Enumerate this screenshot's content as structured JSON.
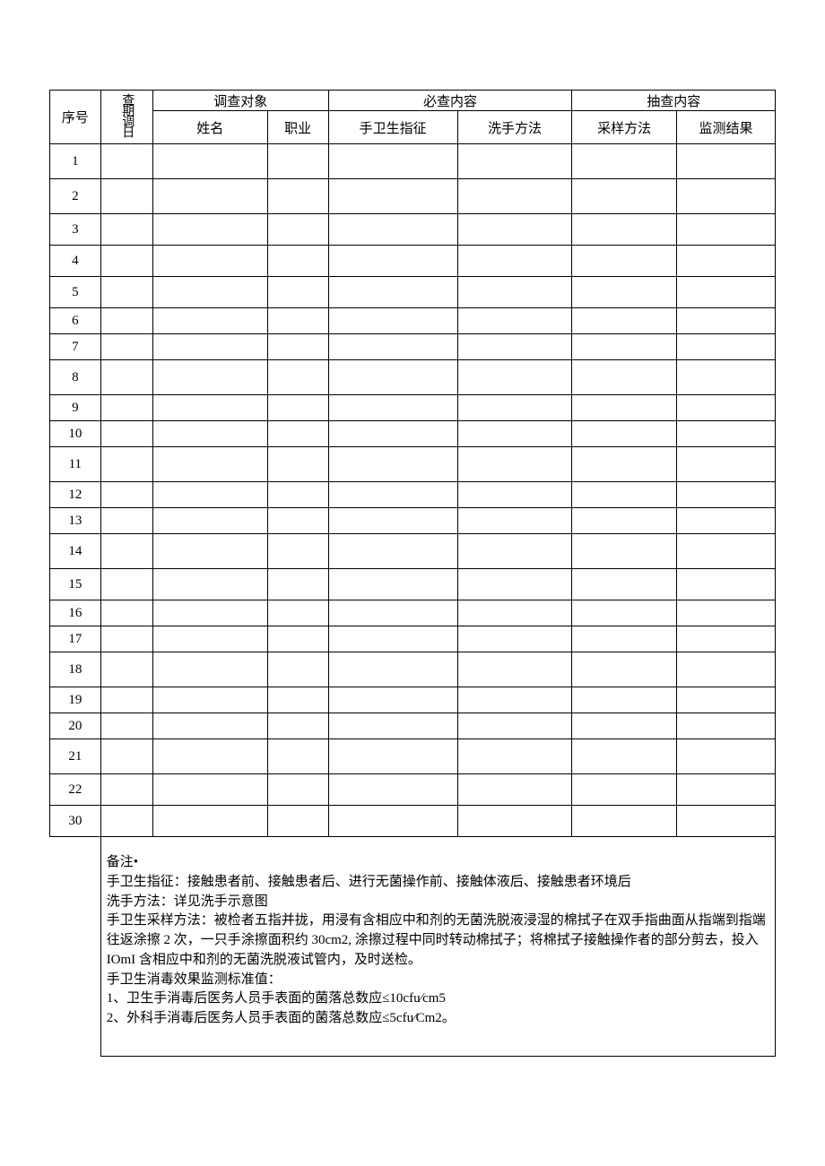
{
  "headers": {
    "col_seq": "序号",
    "col_date": "查期调日",
    "group_subject": "调查对象",
    "group_required": "必查内容",
    "group_sample": "抽查内容",
    "sub_name": "姓名",
    "sub_occupation": "职业",
    "sub_indication": "手卫生指征",
    "sub_wash_method": "洗手方法",
    "sub_sampling_method": "采样方法",
    "sub_result": "监测结果"
  },
  "rows": [
    {
      "seq": "1"
    },
    {
      "seq": "2"
    },
    {
      "seq": "3"
    },
    {
      "seq": "4"
    },
    {
      "seq": "5"
    },
    {
      "seq": "6"
    },
    {
      "seq": "7"
    },
    {
      "seq": "8"
    },
    {
      "seq": "9"
    },
    {
      "seq": "10"
    },
    {
      "seq": "11"
    },
    {
      "seq": "12"
    },
    {
      "seq": "13"
    },
    {
      "seq": "14"
    },
    {
      "seq": "15"
    },
    {
      "seq": "16"
    },
    {
      "seq": "17"
    },
    {
      "seq": "18"
    },
    {
      "seq": "19"
    },
    {
      "seq": "20"
    },
    {
      "seq": "21"
    },
    {
      "seq": "22"
    },
    {
      "seq": "30"
    }
  ],
  "notes": {
    "line0": "备注•",
    "line1": "手卫生指征：接触患者前、接触患者后、进行无菌操作前、接触体液后、接触患者环境后",
    "line2": "洗手方法：详见洗手示意图",
    "line3": "手卫生采样方法：被检者五指并拢，用浸有含相应中和剂的无菌洗脱液浸湿的棉拭子在双手指曲面从指端到指端往返涂擦 2 次，一只手涂擦面积约 30cm2, 涂擦过程中同时转动棉拭子；将棉拭子接触操作者的部分剪去，投入 IOmI 含相应中和剂的无菌洗脱液试管内，及时送检。",
    "line4": "手卫生消毒效果监测标准值：",
    "line5": "1、卫生手消毒后医务人员手表面的菌落总数应≤10cfu∕cm5",
    "line6": "2、外科手消毒后医务人员手表面的菌落总数应≤5cfu∕Cm2。"
  },
  "chart_data": {
    "type": "table",
    "title": "",
    "columns": [
      "序号",
      "查期调日",
      "姓名",
      "职业",
      "手卫生指征",
      "洗手方法",
      "采样方法",
      "监测结果"
    ],
    "rows": [
      [
        "1",
        "",
        "",
        "",
        "",
        "",
        "",
        ""
      ],
      [
        "2",
        "",
        "",
        "",
        "",
        "",
        "",
        ""
      ],
      [
        "3",
        "",
        "",
        "",
        "",
        "",
        "",
        ""
      ],
      [
        "4",
        "",
        "",
        "",
        "",
        "",
        "",
        ""
      ],
      [
        "5",
        "",
        "",
        "",
        "",
        "",
        "",
        ""
      ],
      [
        "6",
        "",
        "",
        "",
        "",
        "",
        "",
        ""
      ],
      [
        "7",
        "",
        "",
        "",
        "",
        "",
        "",
        ""
      ],
      [
        "8",
        "",
        "",
        "",
        "",
        "",
        "",
        ""
      ],
      [
        "9",
        "",
        "",
        "",
        "",
        "",
        "",
        ""
      ],
      [
        "10",
        "",
        "",
        "",
        "",
        "",
        "",
        ""
      ],
      [
        "11",
        "",
        "",
        "",
        "",
        "",
        "",
        ""
      ],
      [
        "12",
        "",
        "",
        "",
        "",
        "",
        "",
        ""
      ],
      [
        "13",
        "",
        "",
        "",
        "",
        "",
        "",
        ""
      ],
      [
        "14",
        "",
        "",
        "",
        "",
        "",
        "",
        ""
      ],
      [
        "15",
        "",
        "",
        "",
        "",
        "",
        "",
        ""
      ],
      [
        "16",
        "",
        "",
        "",
        "",
        "",
        "",
        ""
      ],
      [
        "17",
        "",
        "",
        "",
        "",
        "",
        "",
        ""
      ],
      [
        "18",
        "",
        "",
        "",
        "",
        "",
        "",
        ""
      ],
      [
        "19",
        "",
        "",
        "",
        "",
        "",
        "",
        ""
      ],
      [
        "20",
        "",
        "",
        "",
        "",
        "",
        "",
        ""
      ],
      [
        "21",
        "",
        "",
        "",
        "",
        "",
        "",
        ""
      ],
      [
        "22",
        "",
        "",
        "",
        "",
        "",
        "",
        ""
      ],
      [
        "30",
        "",
        "",
        "",
        "",
        "",
        "",
        ""
      ]
    ]
  }
}
